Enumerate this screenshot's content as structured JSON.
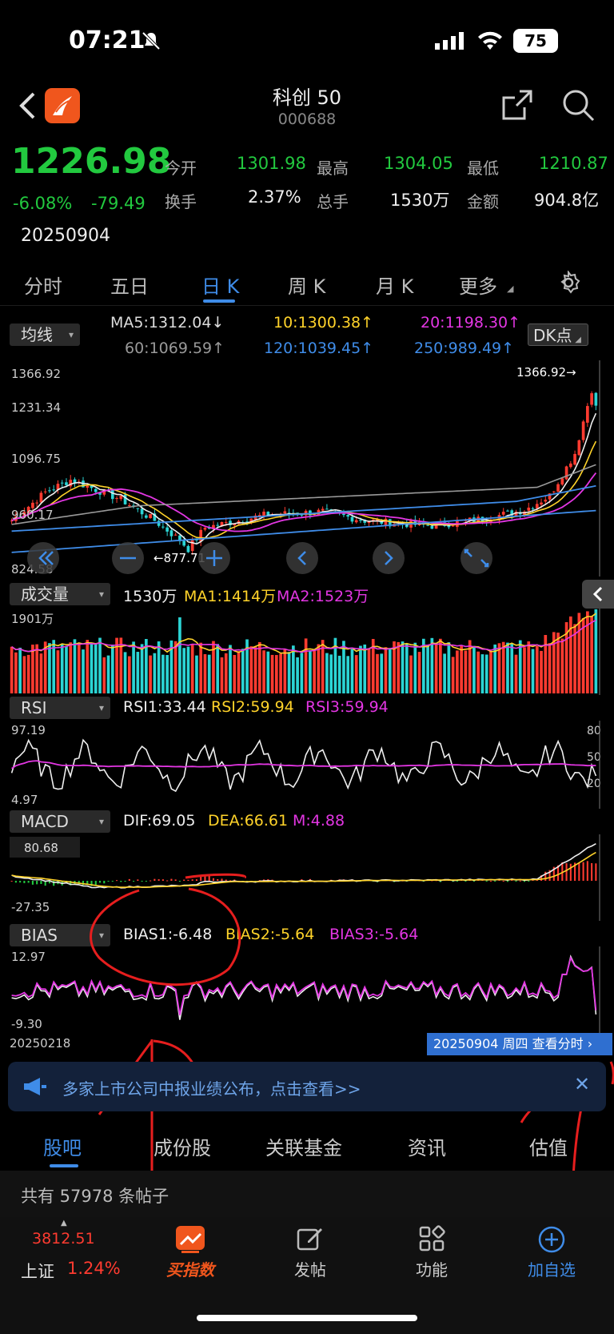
{
  "status_bar": {
    "time": "07:21",
    "battery": "75"
  },
  "header": {
    "title": "科创 50",
    "code": "000688"
  },
  "quote": {
    "price": "1226.98",
    "change_pct": "-6.08%",
    "change": "-79.49",
    "date": "20250904",
    "fields": [
      {
        "label": "今开",
        "value": "1301.98"
      },
      {
        "label": "最高",
        "value": "1304.05"
      },
      {
        "label": "最低",
        "value": "1210.87"
      },
      {
        "label": "换手",
        "value": "2.37%"
      },
      {
        "label": "总手",
        "value": "1530万"
      },
      {
        "label": "金额",
        "value": "904.8亿"
      }
    ]
  },
  "period_tabs": [
    "分时",
    "五日",
    "日 K",
    "周 K",
    "月 K",
    "更多"
  ],
  "ma_panel": {
    "dropdown": "均线",
    "dk_button": "DK点",
    "ma": [
      {
        "label": "MA5:1312.04↓",
        "color": "#dddddd"
      },
      {
        "label": "10:1300.38↑",
        "color": "#ffd32a"
      },
      {
        "label": "20:1198.30↑",
        "color": "#e336e3"
      },
      {
        "label": "60:1069.59↑",
        "color": "#999999"
      },
      {
        "label": "120:1039.45↑",
        "color": "#3f8ce8"
      },
      {
        "label": "250:989.49↑",
        "color": "#3f8ce8"
      }
    ],
    "y_ticks": [
      "1366.92",
      "1231.34",
      "1096.75",
      "960.17",
      "824.58"
    ],
    "high_label": "1366.92→",
    "low_label": "←877.71"
  },
  "volume_panel": {
    "dropdown": "成交量",
    "vol": "1530万",
    "ma1": "MA1:1414万",
    "ma2": "MA2:1523万",
    "y_top": "1901万"
  },
  "rsi_panel": {
    "dropdown": "RSI",
    "rsi1": "RSI1:33.44",
    "rsi2": "RSI2:59.94",
    "rsi3": "RSI3:59.94",
    "y_top": "97.19",
    "y_bottom": "4.97",
    "right_ticks": [
      "80",
      "50",
      "20"
    ]
  },
  "macd_panel": {
    "dropdown": "MACD",
    "dif": "DIF:69.05",
    "dea": "DEA:66.61",
    "m": "M:4.88",
    "y_top": "80.68",
    "y_bottom": "-27.35"
  },
  "bias_panel": {
    "dropdown": "BIAS",
    "bias1": "BIAS1:-6.48",
    "bias2": "BIAS2:-5.64",
    "bias3": "BIAS3:-5.64",
    "y_top": "12.97",
    "y_bottom": "-9.30",
    "start_date": "20250218",
    "end_badge": "20250904 周四 查看分时"
  },
  "notice": "多家上市公司中报业绩公布，点击查看>>",
  "lower_tabs": [
    "股吧",
    "成份股",
    "关联基金",
    "资讯",
    "估值"
  ],
  "posts": "共有 57978 条帖子",
  "bottom_bar": {
    "index_value": "3812.51",
    "index_name": "上证",
    "index_pct": "1.24%",
    "items": [
      "买指数",
      "发帖",
      "功能",
      "加自选"
    ]
  },
  "colors": {
    "up": "#ff3b30",
    "down": "#22c93f",
    "accent": "#3f8ce8",
    "bg": "#000000"
  }
}
